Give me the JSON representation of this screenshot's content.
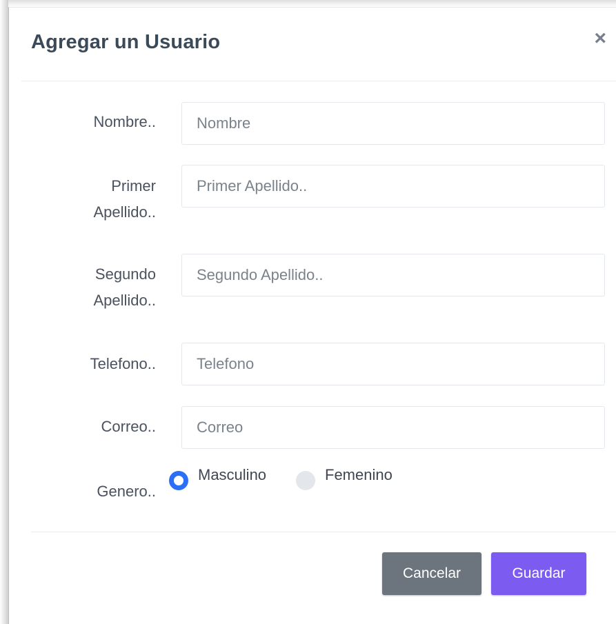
{
  "modal": {
    "title": "Agregar un Usuario",
    "close_label": "×"
  },
  "form": {
    "nombre": {
      "label": "Nombre..",
      "placeholder": "Nombre",
      "value": ""
    },
    "primer_apellido": {
      "label_line1": "Primer",
      "label_line2": "Apellido..",
      "placeholder": "Primer Apellido..",
      "value": ""
    },
    "segundo_apellido": {
      "label_line1": "Segundo",
      "label_line2": "Apellido..",
      "placeholder": "Segundo Apellido..",
      "value": ""
    },
    "telefono": {
      "label": "Telefono..",
      "placeholder": "Telefono",
      "value": ""
    },
    "correo": {
      "label": "Correo..",
      "placeholder": "Correo",
      "value": ""
    },
    "genero": {
      "label": "Genero..",
      "options": [
        {
          "label": "Masculino",
          "checked": true
        },
        {
          "label": "Femenino",
          "checked": false
        }
      ]
    }
  },
  "footer": {
    "cancel_label": "Cancelar",
    "save_label": "Guardar"
  },
  "colors": {
    "title": "#3b4a59",
    "radio_checked": "#2b6ef7",
    "cancel_button": "#6c757d",
    "save_button": "#7c5cf0"
  }
}
